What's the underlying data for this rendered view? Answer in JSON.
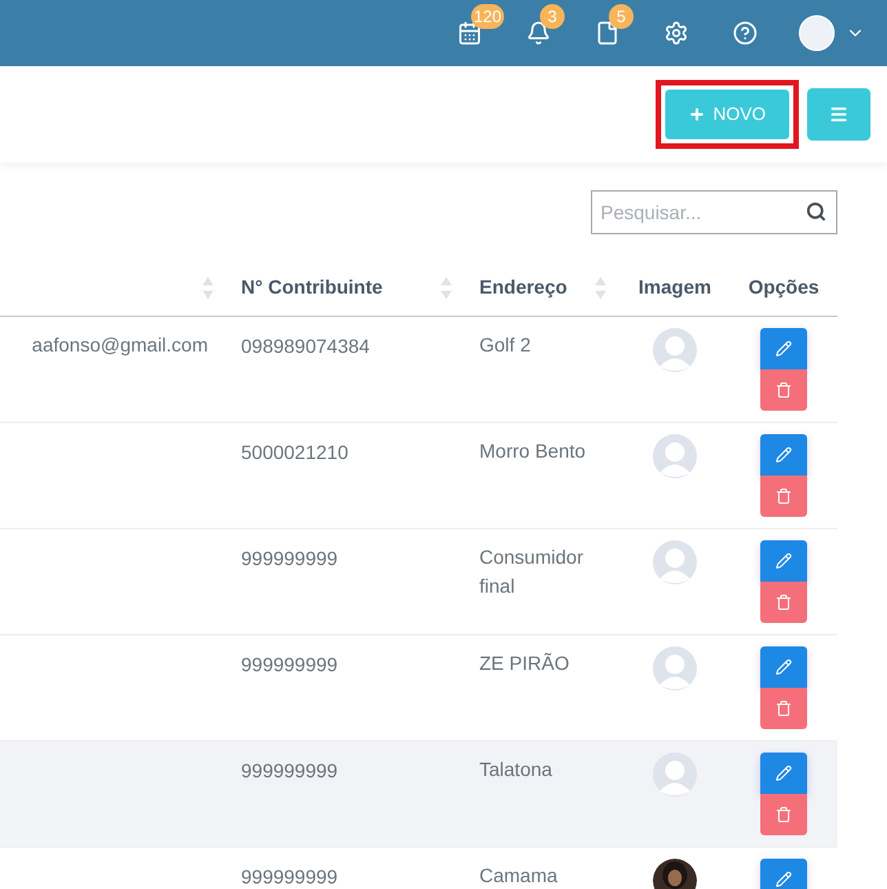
{
  "topbar": {
    "badges": [
      {
        "kind": "calendar",
        "count": "120"
      },
      {
        "kind": "bell",
        "count": "3"
      },
      {
        "kind": "document",
        "count": "5"
      }
    ]
  },
  "toolbar": {
    "new_button": {
      "label": "NOVO",
      "highlighted": true
    }
  },
  "search": {
    "placeholder": "Pesquisar..."
  },
  "table": {
    "columns": [
      {
        "sortable": true
      },
      {
        "label": "N° Contribuinte",
        "sortable": true
      },
      {
        "label": "Endereço",
        "sortable": true
      },
      {
        "label": "Imagem"
      },
      {
        "label": "Opções"
      }
    ],
    "rows": [
      {
        "column_1": "aafonso@gmail.com",
        "contribuinte": "098989074384",
        "endereco": "Golf 2",
        "kind": "placeholder",
        "hover": false
      },
      {
        "contribuinte": "5000021210",
        "endereco": "Morro Bento",
        "kind": "placeholder",
        "hover": false
      },
      {
        "contribuinte": "999999999",
        "endereco": "Consumidor final",
        "kind": "placeholder",
        "hover": false
      },
      {
        "contribuinte": "999999999",
        "endereco": "ZE PIRÃO",
        "kind": "placeholder",
        "hover": false
      },
      {
        "contribuinte": "999999999",
        "endereco": "Talatona",
        "kind": "placeholder",
        "hover": true
      },
      {
        "contribuinte": "999999999",
        "endereco": "Camama",
        "kind": "picture",
        "hover": false
      }
    ]
  }
}
